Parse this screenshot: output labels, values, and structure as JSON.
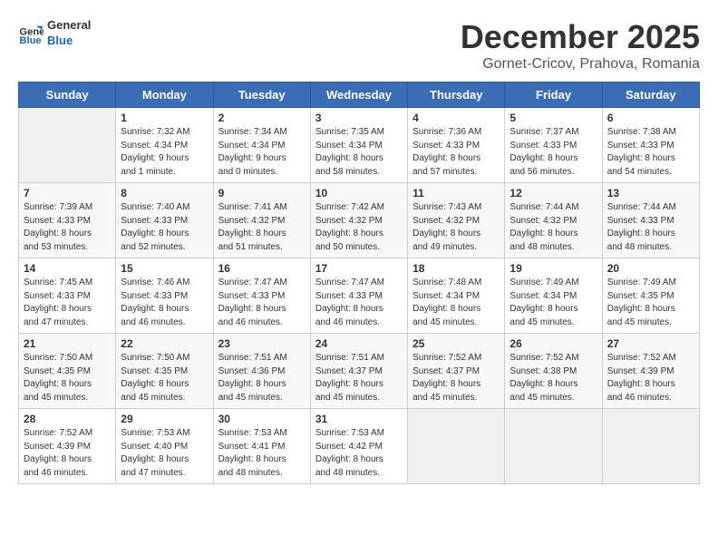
{
  "logo": {
    "line1": "General",
    "line2": "Blue"
  },
  "title": "December 2025",
  "subtitle": "Gornet-Cricov, Prahova, Romania",
  "days_header": [
    "Sunday",
    "Monday",
    "Tuesday",
    "Wednesday",
    "Thursday",
    "Friday",
    "Saturday"
  ],
  "weeks": [
    [
      {
        "day": "",
        "info": ""
      },
      {
        "day": "1",
        "info": "Sunrise: 7:32 AM\nSunset: 4:34 PM\nDaylight: 9 hours\nand 1 minute."
      },
      {
        "day": "2",
        "info": "Sunrise: 7:34 AM\nSunset: 4:34 PM\nDaylight: 9 hours\nand 0 minutes."
      },
      {
        "day": "3",
        "info": "Sunrise: 7:35 AM\nSunset: 4:34 PM\nDaylight: 8 hours\nand 58 minutes."
      },
      {
        "day": "4",
        "info": "Sunrise: 7:36 AM\nSunset: 4:33 PM\nDaylight: 8 hours\nand 57 minutes."
      },
      {
        "day": "5",
        "info": "Sunrise: 7:37 AM\nSunset: 4:33 PM\nDaylight: 8 hours\nand 56 minutes."
      },
      {
        "day": "6",
        "info": "Sunrise: 7:38 AM\nSunset: 4:33 PM\nDaylight: 8 hours\nand 54 minutes."
      }
    ],
    [
      {
        "day": "7",
        "info": "Sunrise: 7:39 AM\nSunset: 4:33 PM\nDaylight: 8 hours\nand 53 minutes."
      },
      {
        "day": "8",
        "info": "Sunrise: 7:40 AM\nSunset: 4:33 PM\nDaylight: 8 hours\nand 52 minutes."
      },
      {
        "day": "9",
        "info": "Sunrise: 7:41 AM\nSunset: 4:32 PM\nDaylight: 8 hours\nand 51 minutes."
      },
      {
        "day": "10",
        "info": "Sunrise: 7:42 AM\nSunset: 4:32 PM\nDaylight: 8 hours\nand 50 minutes."
      },
      {
        "day": "11",
        "info": "Sunrise: 7:43 AM\nSunset: 4:32 PM\nDaylight: 8 hours\nand 49 minutes."
      },
      {
        "day": "12",
        "info": "Sunrise: 7:44 AM\nSunset: 4:32 PM\nDaylight: 8 hours\nand 48 minutes."
      },
      {
        "day": "13",
        "info": "Sunrise: 7:44 AM\nSunset: 4:33 PM\nDaylight: 8 hours\nand 48 minutes."
      }
    ],
    [
      {
        "day": "14",
        "info": "Sunrise: 7:45 AM\nSunset: 4:33 PM\nDaylight: 8 hours\nand 47 minutes."
      },
      {
        "day": "15",
        "info": "Sunrise: 7:46 AM\nSunset: 4:33 PM\nDaylight: 8 hours\nand 46 minutes."
      },
      {
        "day": "16",
        "info": "Sunrise: 7:47 AM\nSunset: 4:33 PM\nDaylight: 8 hours\nand 46 minutes."
      },
      {
        "day": "17",
        "info": "Sunrise: 7:47 AM\nSunset: 4:33 PM\nDaylight: 8 hours\nand 46 minutes."
      },
      {
        "day": "18",
        "info": "Sunrise: 7:48 AM\nSunset: 4:34 PM\nDaylight: 8 hours\nand 45 minutes."
      },
      {
        "day": "19",
        "info": "Sunrise: 7:49 AM\nSunset: 4:34 PM\nDaylight: 8 hours\nand 45 minutes."
      },
      {
        "day": "20",
        "info": "Sunrise: 7:49 AM\nSunset: 4:35 PM\nDaylight: 8 hours\nand 45 minutes."
      }
    ],
    [
      {
        "day": "21",
        "info": "Sunrise: 7:50 AM\nSunset: 4:35 PM\nDaylight: 8 hours\nand 45 minutes."
      },
      {
        "day": "22",
        "info": "Sunrise: 7:50 AM\nSunset: 4:35 PM\nDaylight: 8 hours\nand 45 minutes."
      },
      {
        "day": "23",
        "info": "Sunrise: 7:51 AM\nSunset: 4:36 PM\nDaylight: 8 hours\nand 45 minutes."
      },
      {
        "day": "24",
        "info": "Sunrise: 7:51 AM\nSunset: 4:37 PM\nDaylight: 8 hours\nand 45 minutes."
      },
      {
        "day": "25",
        "info": "Sunrise: 7:52 AM\nSunset: 4:37 PM\nDaylight: 8 hours\nand 45 minutes."
      },
      {
        "day": "26",
        "info": "Sunrise: 7:52 AM\nSunset: 4:38 PM\nDaylight: 8 hours\nand 45 minutes."
      },
      {
        "day": "27",
        "info": "Sunrise: 7:52 AM\nSunset: 4:39 PM\nDaylight: 8 hours\nand 46 minutes."
      }
    ],
    [
      {
        "day": "28",
        "info": "Sunrise: 7:52 AM\nSunset: 4:39 PM\nDaylight: 8 hours\nand 46 minutes."
      },
      {
        "day": "29",
        "info": "Sunrise: 7:53 AM\nSunset: 4:40 PM\nDaylight: 8 hours\nand 47 minutes."
      },
      {
        "day": "30",
        "info": "Sunrise: 7:53 AM\nSunset: 4:41 PM\nDaylight: 8 hours\nand 48 minutes."
      },
      {
        "day": "31",
        "info": "Sunrise: 7:53 AM\nSunset: 4:42 PM\nDaylight: 8 hours\nand 48 minutes."
      },
      {
        "day": "",
        "info": ""
      },
      {
        "day": "",
        "info": ""
      },
      {
        "day": "",
        "info": ""
      }
    ]
  ]
}
